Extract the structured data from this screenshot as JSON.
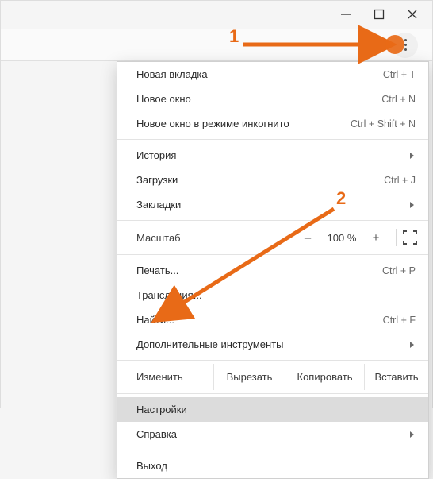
{
  "annotations": {
    "one": "1",
    "two": "2",
    "color": "#e86a17"
  },
  "menu": {
    "new_tab": {
      "label": "Новая вкладка",
      "shortcut": "Ctrl + T"
    },
    "new_window": {
      "label": "Новое окно",
      "shortcut": "Ctrl + N"
    },
    "incognito": {
      "label": "Новое окно в режиме инкогнито",
      "shortcut": "Ctrl + Shift + N"
    },
    "history": {
      "label": "История"
    },
    "downloads": {
      "label": "Загрузки",
      "shortcut": "Ctrl + J"
    },
    "bookmarks": {
      "label": "Закладки"
    },
    "zoom": {
      "label": "Масштаб",
      "value": "100 %",
      "minus": "–",
      "plus": "+"
    },
    "print": {
      "label": "Печать...",
      "shortcut": "Ctrl + P"
    },
    "cast": {
      "label": "Трансляция..."
    },
    "find": {
      "label": "Найти...",
      "shortcut": "Ctrl + F"
    },
    "more_tools": {
      "label": "Дополнительные инструменты"
    },
    "edit": {
      "label": "Изменить",
      "cut": "Вырезать",
      "copy": "Копировать",
      "paste": "Вставить"
    },
    "settings": {
      "label": "Настройки"
    },
    "help": {
      "label": "Справка"
    },
    "exit": {
      "label": "Выход"
    }
  }
}
